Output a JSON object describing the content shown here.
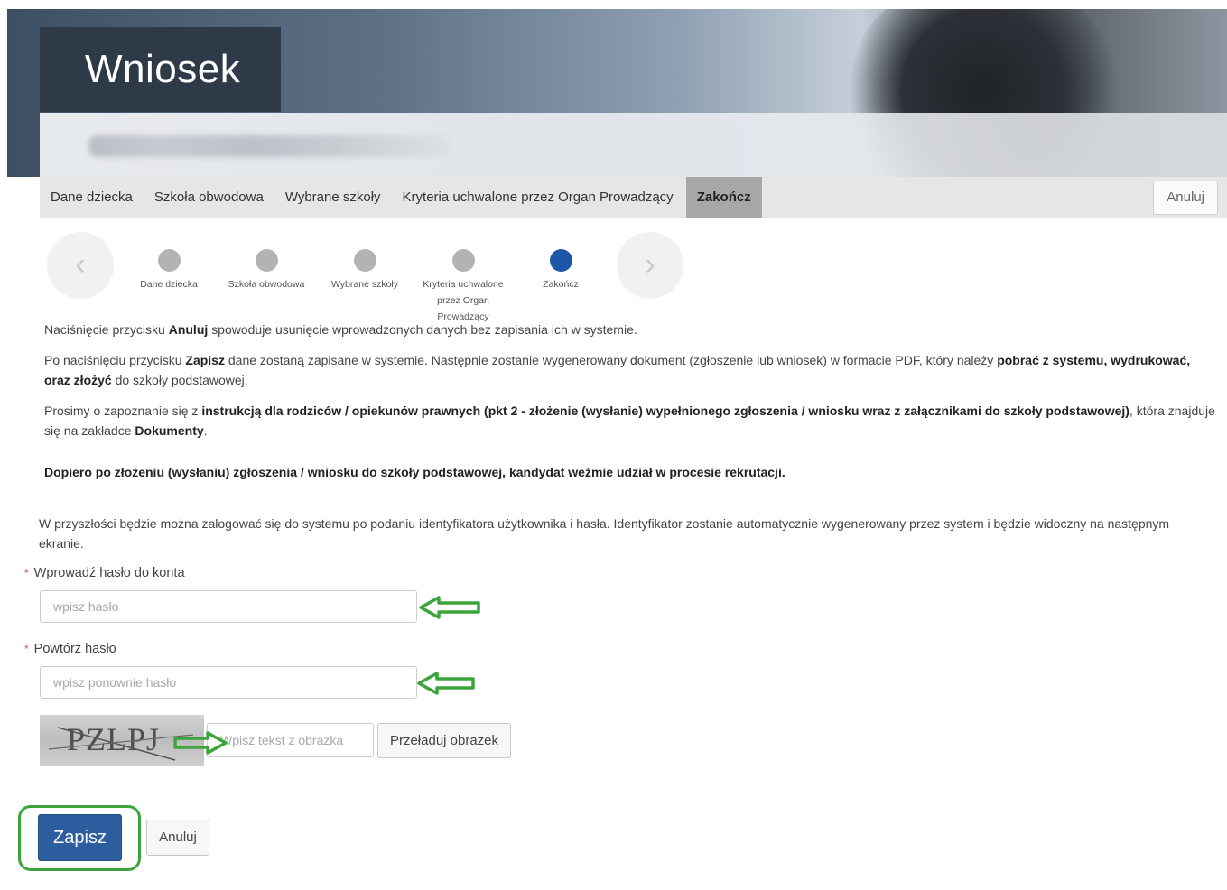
{
  "header": {
    "title": "Wniosek"
  },
  "tabs": {
    "items": [
      "Dane dziecka",
      "Szkoła obwodowa",
      "Wybrane szkoły",
      "Kryteria uchwalone przez Organ Prowadzący",
      "Zakończ"
    ],
    "active": "Zakończ",
    "cancel_label": "Anuluj"
  },
  "stepper": {
    "steps": [
      {
        "label": "Dane dziecka",
        "state": "done"
      },
      {
        "label": "Szkoła obwodowa",
        "state": "done"
      },
      {
        "label": "Wybrane szkoły",
        "state": "done"
      },
      {
        "label": "Kryteria uchwalone przez Organ Prowadzący",
        "state": "done"
      },
      {
        "label": "Zakończ",
        "state": "current"
      }
    ],
    "prev_icon": "chevron-left-icon",
    "next_icon": "chevron-right-icon"
  },
  "info": {
    "p1_a": "Naciśnięcie przycisku ",
    "p1_b": "Anuluj",
    "p1_c": " spowoduje usunięcie wprowadzonych danych bez zapisania ich w systemie.",
    "p2_a": "Po naciśnięciu przycisku ",
    "p2_b": "Zapisz",
    "p2_c": " dane zostaną zapisane w systemie. Następnie zostanie wygenerowany dokument (zgłoszenie lub wniosek) w formacie PDF, który należy ",
    "p2_d": "pobrać z systemu, wydrukować, oraz złożyć",
    "p2_e": " do szkoły podstawowej.",
    "p3_a": "Prosimy o zapoznanie się z ",
    "p3_b": "instrukcją dla rodziców / opiekunów prawnych (pkt 2 - złożenie (wysłanie) wypełnionego zgłoszenia / wniosku wraz z załącznikami do szkoły podstawowej)",
    "p3_c": ", która znajduje się na zakładce ",
    "p3_d": "Dokumenty",
    "p3_e": ".",
    "p4": "Dopiero po złożeniu (wysłaniu) zgłoszenia / wniosku do szkoły podstawowej, kandydat weźmie udział w procesie rekrutacji.",
    "p5": "W przyszłości będzie można zalogować się do systemu po podaniu identyfikatora użytkownika i hasła. Identyfikator zostanie automatycznie wygenerowany przez system i będzie widoczny na następnym ekranie."
  },
  "form": {
    "required_mark": "*",
    "password_label": "Wprowadź hasło do konta",
    "password_placeholder": "wpisz hasło",
    "password_value": "",
    "repeat_label": "Powtórz hasło",
    "repeat_placeholder": "wpisz ponownie hasło",
    "repeat_value": "",
    "captcha_text": "PZLPJ",
    "captcha_placeholder": "Wpisz tekst z obrazka",
    "captcha_value": "",
    "reload_label": "Przeładuj obrazek"
  },
  "actions": {
    "save_label": "Zapisz",
    "cancel_label": "Anuluj"
  },
  "colors": {
    "primary": "#2c5d9e",
    "current_step": "#1e56a8",
    "done_step": "#b3b3b3",
    "annotation_green": "#3ba53b",
    "required": "#d9534f"
  }
}
